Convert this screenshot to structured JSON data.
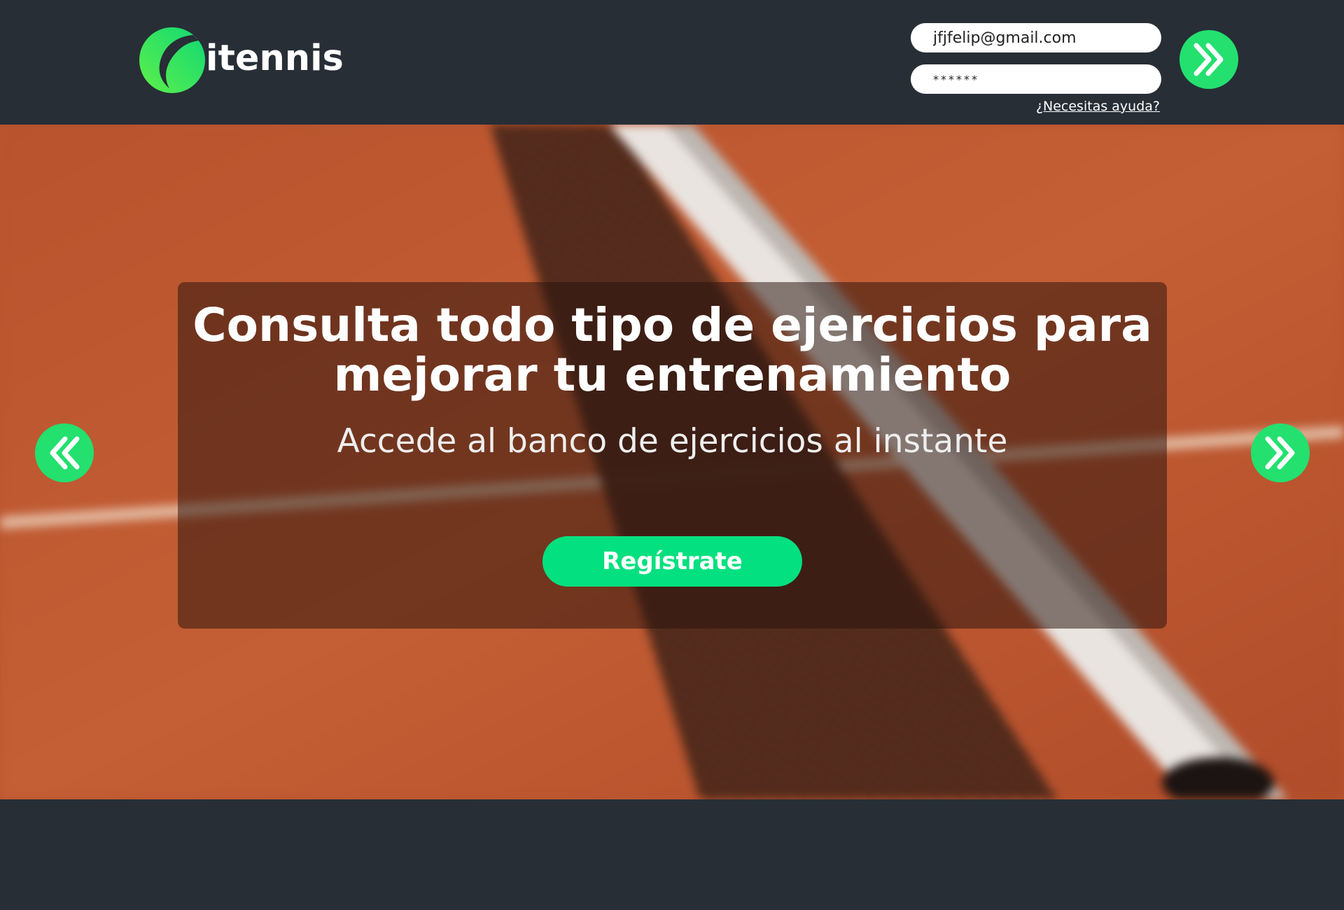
{
  "header": {
    "logo_text": "itennis",
    "logo_icon": "tennis-ball-icon",
    "login": {
      "email_value": "jfjfelip@gmail.com",
      "password_value": "******",
      "help_link": "¿Necesitas ayuda?",
      "submit_icon": "double-chevron-right-icon"
    }
  },
  "hero": {
    "title": "Consulta todo tipo de ejercicios para mejorar tu entrenamiento",
    "subtitle": "Accede al banco de ejercicios al instante",
    "cta_label": "Regístrate",
    "prev_icon": "double-chevron-left-icon",
    "next_icon": "double-chevron-right-icon",
    "background": "blurred clay tennis court with net"
  },
  "colors": {
    "page_bg": "#272e36",
    "accent_green": "#23e06f",
    "cta_green": "#03e07f",
    "clay": "#b9552f"
  }
}
